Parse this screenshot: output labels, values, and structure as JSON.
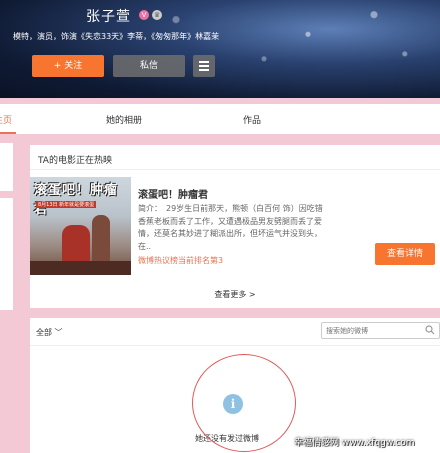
{
  "profile": {
    "name": "张子萱",
    "vip_badge": "V",
    "crown_badge": "♛",
    "bio": "模特，演员，饰演《失恋33天》李蒂，《匆匆那年》林嘉茉"
  },
  "actions": {
    "follow_label": "+ 关注",
    "message_label": "私信"
  },
  "tabs": [
    {
      "label": "主页"
    },
    {
      "label": "她的相册"
    },
    {
      "label": "作品"
    }
  ],
  "movie_section": {
    "title": "TA的电影正在热映",
    "poster_title": "滚蛋吧！肿瘤君",
    "poster_subtitle": "8月13日 新年就是要滚蛋",
    "movie_name": "滚蛋吧！肿瘤君",
    "description": "简介：　29岁生日前那天，熊顿（白百何 饰）因吃错香蕉老板而丢了工作，又遭遇极品男友劈腿而丢了爱情，还莫名其妙进了糊派出所，但坏运气并没到头，在..",
    "rank": "微博热议榜当前排名第3",
    "detail_button": "查看详情",
    "see_more": "查看更多 >"
  },
  "feed": {
    "filter_label": "全部 ﹀",
    "search_placeholder": "搜索她的微博",
    "empty_text": "她还没有发过微博"
  },
  "watermark": "幸福情感网 www.xfqgw.com",
  "colors": {
    "accent": "#f7752f",
    "page_bg": "#f3c9d6",
    "link": "#eb7350"
  }
}
